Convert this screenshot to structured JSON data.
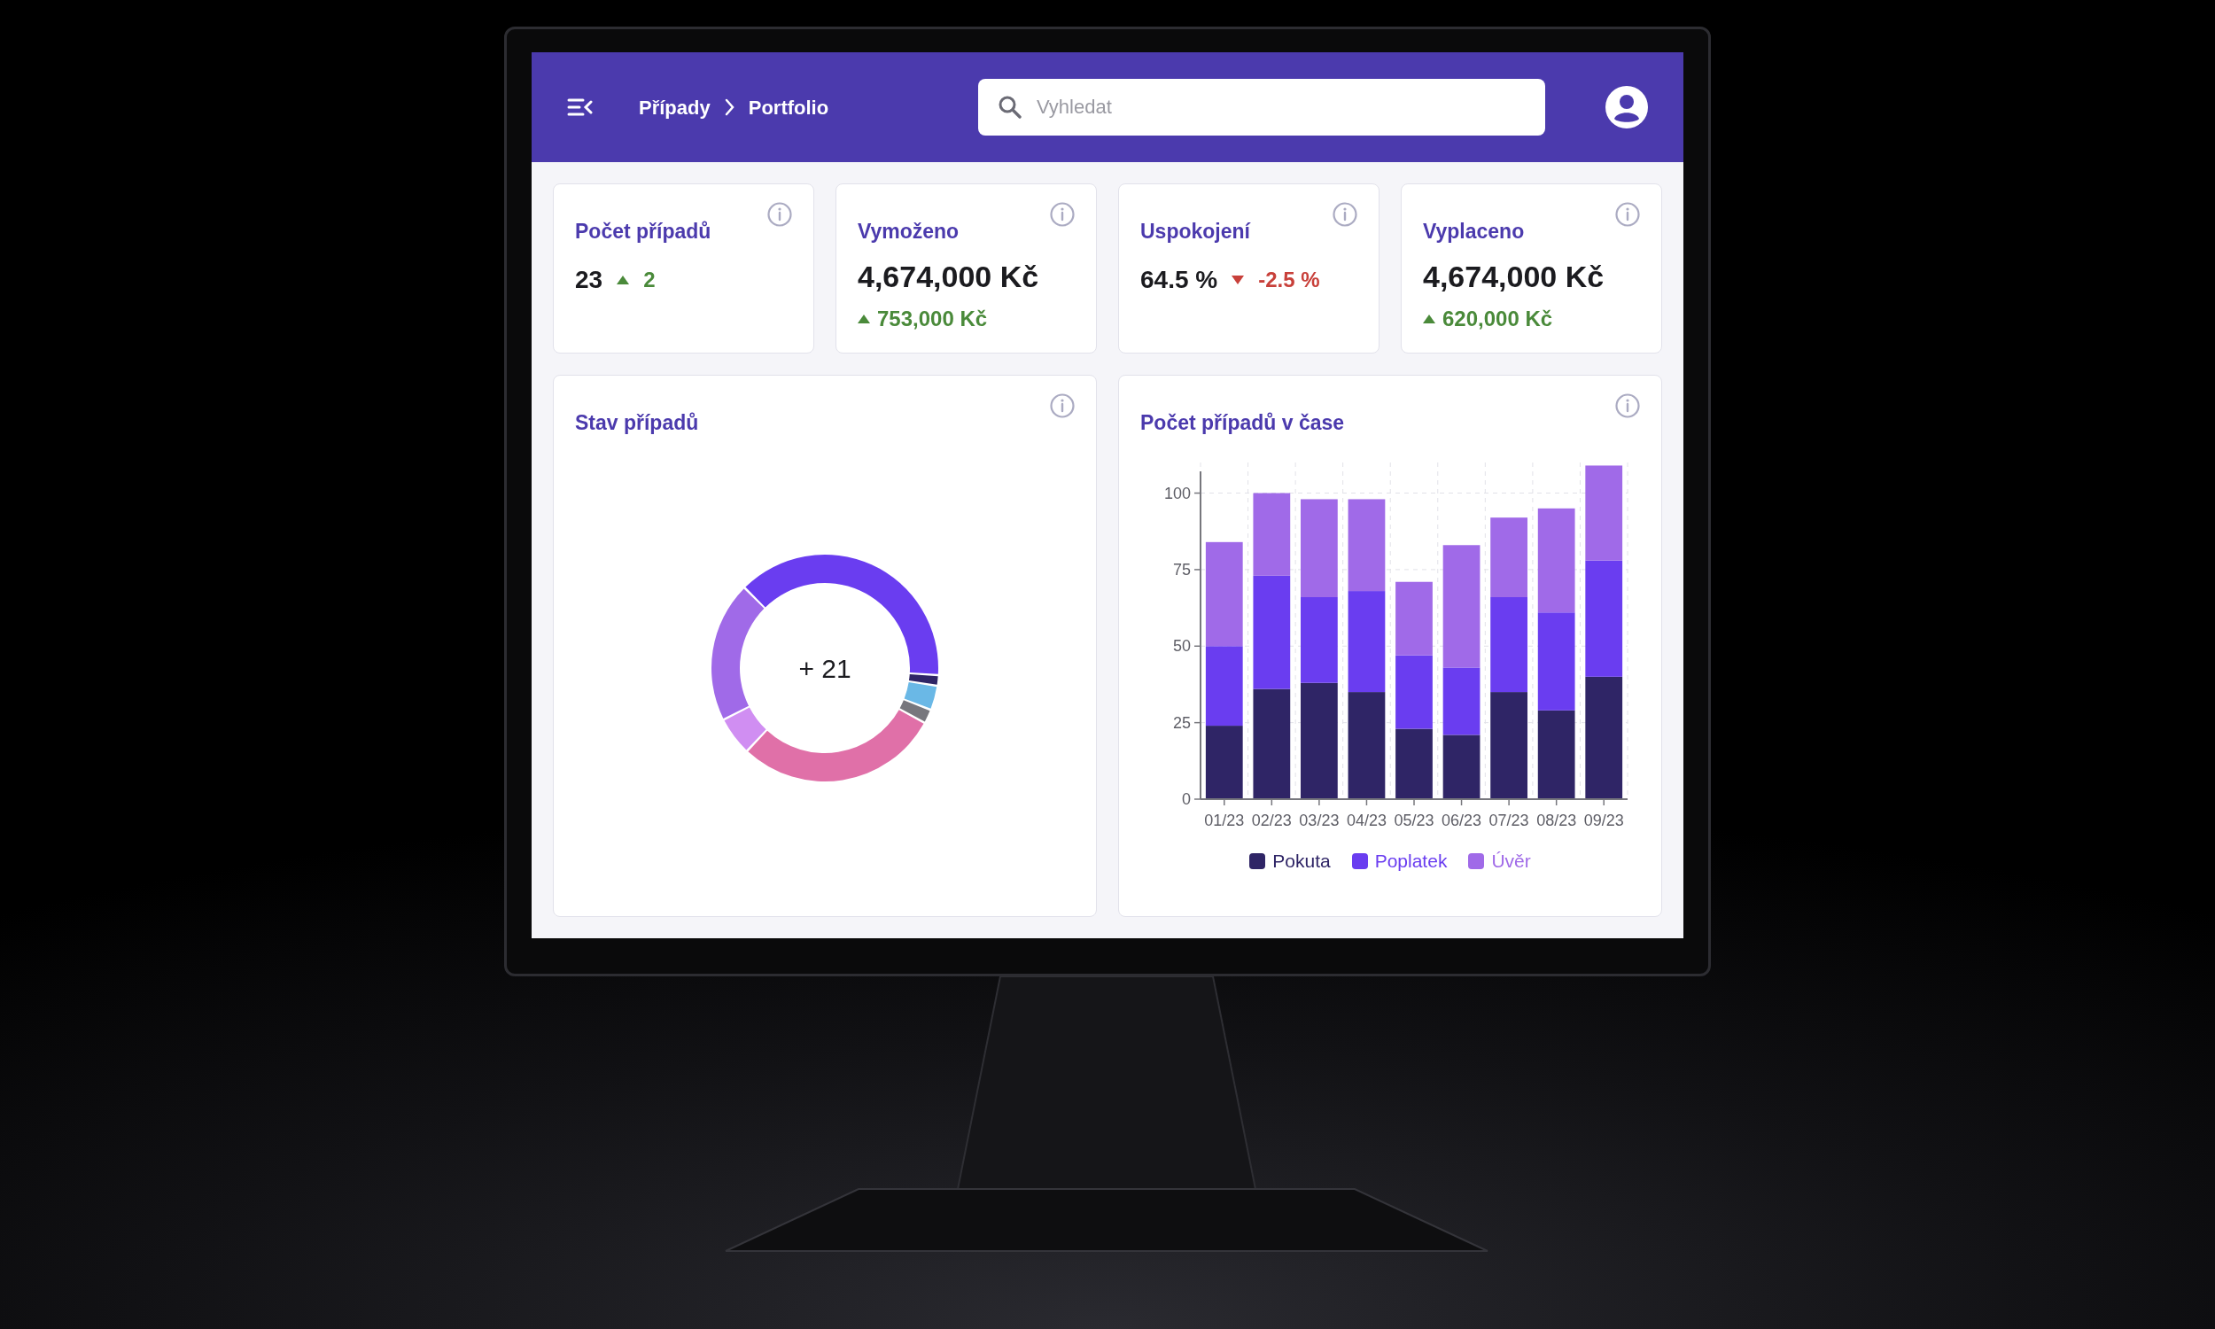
{
  "header": {
    "breadcrumb": [
      "Případy",
      "Portfolio"
    ],
    "search": {
      "placeholder": "Vyhledat"
    }
  },
  "stat_cards": [
    {
      "kind": "inline",
      "title": "Počet případů",
      "value": "23",
      "rising": true,
      "delta": "2"
    },
    {
      "kind": "stacked",
      "title": "Vymoženo",
      "value": "4,674,000 Kč",
      "rising": true,
      "delta": "753,000 Kč"
    },
    {
      "kind": "inline",
      "title": "Uspokojení",
      "value": "64.5 %",
      "rising": false,
      "delta": "-2.5 %"
    },
    {
      "kind": "stacked",
      "title": "Vyplaceno",
      "value": "4,674,000 Kč",
      "rising": true,
      "delta": "620,000 Kč"
    }
  ],
  "status_panel": {
    "title": "Stav případů",
    "center_label": "+ 21"
  },
  "timeline_panel": {
    "chart_data": {
      "type": "bar",
      "title": "Počet případů v čase",
      "categories": [
        "01/23",
        "02/23",
        "03/23",
        "04/23",
        "05/23",
        "06/23",
        "07/23",
        "08/23",
        "09/23"
      ],
      "series": [
        {
          "name": "Pokuta",
          "color": "#2f2566",
          "values": [
            24,
            36,
            38,
            35,
            23,
            21,
            35,
            29,
            40
          ]
        },
        {
          "name": "Poplatek",
          "color": "#6a3df0",
          "values": [
            26,
            37,
            28,
            33,
            24,
            22,
            31,
            32,
            38
          ]
        },
        {
          "name": "Úvěr",
          "color": "#a06ae8",
          "values": [
            34,
            27,
            32,
            30,
            24,
            40,
            26,
            34,
            31
          ]
        }
      ],
      "ylim": [
        0,
        110
      ],
      "yticks": [
        0,
        25,
        50,
        75,
        100
      ],
      "stacked": true,
      "grid": true
    }
  }
}
